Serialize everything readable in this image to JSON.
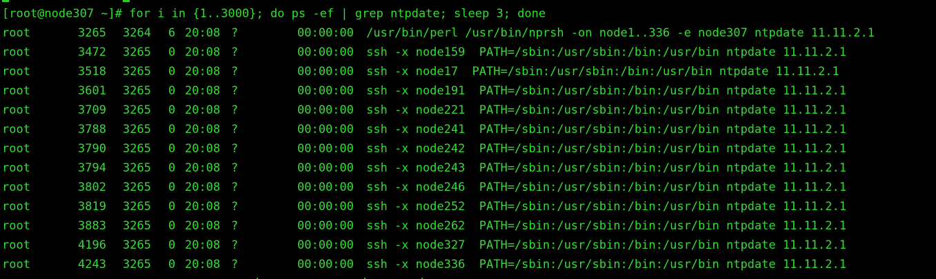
{
  "terminal": {
    "prompt": "[root@node307 ~]#",
    "command": "for i in {1..3000}; do ps -ef | grep ntpdate; sleep 3; done",
    "colors": {
      "background": "#000000",
      "foreground": "#33dd33"
    }
  },
  "processes": [
    {
      "user": "root",
      "pid": "3265",
      "ppid": "3264",
      "c": "6",
      "stime": "20:08",
      "tty": "?",
      "time": "00:00:00",
      "cmd": "/usr/bin/perl /usr/bin/nprsh -on node1..336 -e node307 ntpdate 11.11.2.1"
    },
    {
      "user": "root",
      "pid": "3472",
      "ppid": "3265",
      "c": "0",
      "stime": "20:08",
      "tty": "?",
      "time": "00:00:00",
      "cmd": "ssh -x node159  PATH=/sbin:/usr/sbin:/bin:/usr/bin ntpdate 11.11.2.1"
    },
    {
      "user": "root",
      "pid": "3518",
      "ppid": "3265",
      "c": "0",
      "stime": "20:08",
      "tty": "?",
      "time": "00:00:00",
      "cmd": "ssh -x node17  PATH=/sbin:/usr/sbin:/bin:/usr/bin ntpdate 11.11.2.1"
    },
    {
      "user": "root",
      "pid": "3601",
      "ppid": "3265",
      "c": "0",
      "stime": "20:08",
      "tty": "?",
      "time": "00:00:00",
      "cmd": "ssh -x node191  PATH=/sbin:/usr/sbin:/bin:/usr/bin ntpdate 11.11.2.1"
    },
    {
      "user": "root",
      "pid": "3709",
      "ppid": "3265",
      "c": "0",
      "stime": "20:08",
      "tty": "?",
      "time": "00:00:00",
      "cmd": "ssh -x node221  PATH=/sbin:/usr/sbin:/bin:/usr/bin ntpdate 11.11.2.1"
    },
    {
      "user": "root",
      "pid": "3788",
      "ppid": "3265",
      "c": "0",
      "stime": "20:08",
      "tty": "?",
      "time": "00:00:00",
      "cmd": "ssh -x node241  PATH=/sbin:/usr/sbin:/bin:/usr/bin ntpdate 11.11.2.1"
    },
    {
      "user": "root",
      "pid": "3790",
      "ppid": "3265",
      "c": "0",
      "stime": "20:08",
      "tty": "?",
      "time": "00:00:00",
      "cmd": "ssh -x node242  PATH=/sbin:/usr/sbin:/bin:/usr/bin ntpdate 11.11.2.1"
    },
    {
      "user": "root",
      "pid": "3794",
      "ppid": "3265",
      "c": "0",
      "stime": "20:08",
      "tty": "?",
      "time": "00:00:00",
      "cmd": "ssh -x node243  PATH=/sbin:/usr/sbin:/bin:/usr/bin ntpdate 11.11.2.1"
    },
    {
      "user": "root",
      "pid": "3802",
      "ppid": "3265",
      "c": "0",
      "stime": "20:08",
      "tty": "?",
      "time": "00:00:00",
      "cmd": "ssh -x node246  PATH=/sbin:/usr/sbin:/bin:/usr/bin ntpdate 11.11.2.1"
    },
    {
      "user": "root",
      "pid": "3819",
      "ppid": "3265",
      "c": "0",
      "stime": "20:08",
      "tty": "?",
      "time": "00:00:00",
      "cmd": "ssh -x node252  PATH=/sbin:/usr/sbin:/bin:/usr/bin ntpdate 11.11.2.1"
    },
    {
      "user": "root",
      "pid": "3883",
      "ppid": "3265",
      "c": "0",
      "stime": "20:08",
      "tty": "?",
      "time": "00:00:00",
      "cmd": "ssh -x node262  PATH=/sbin:/usr/sbin:/bin:/usr/bin ntpdate 11.11.2.1"
    },
    {
      "user": "root",
      "pid": "4196",
      "ppid": "3265",
      "c": "0",
      "stime": "20:08",
      "tty": "?",
      "time": "00:00:00",
      "cmd": "ssh -x node327  PATH=/sbin:/usr/sbin:/bin:/usr/bin ntpdate 11.11.2.1"
    },
    {
      "user": "root",
      "pid": "4243",
      "ppid": "3265",
      "c": "0",
      "stime": "20:08",
      "tty": "?",
      "time": "00:00:00",
      "cmd": "ssh -x node336  PATH=/sbin:/usr/sbin:/bin:/usr/bin ntpdate 11.11.2.1"
    }
  ]
}
